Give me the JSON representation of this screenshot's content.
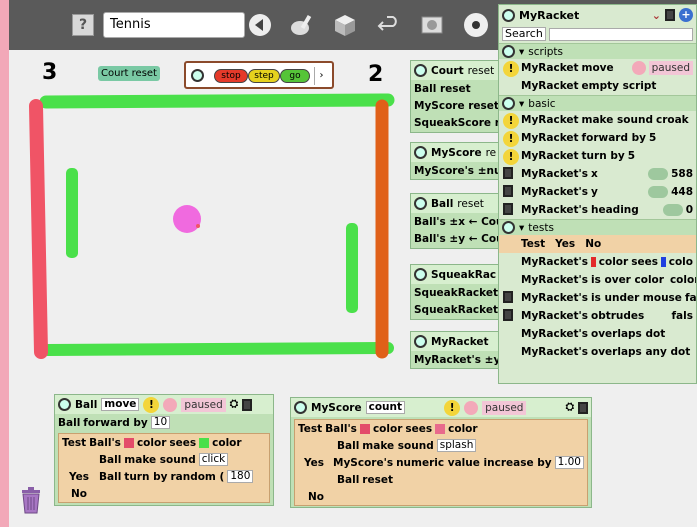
{
  "toolbar": {
    "help_icon": "?",
    "project_name": "Tennis",
    "icons": [
      "back-arrow-icon",
      "paint-icon",
      "object-catalog-icon",
      "undo-icon",
      "navigator-icon",
      "stop-dot-icon"
    ]
  },
  "scores": {
    "left": "3",
    "right": "2"
  },
  "court_reset_button": "Court reset",
  "stop_step_go": {
    "stop": "stop",
    "step": "step",
    "go": "go"
  },
  "colors": {
    "world_bg": "#efefef",
    "topbar_bg": "#5a5a5a",
    "green_wall": "#4ae04a",
    "red_wall": "#f05466",
    "orange_wall": "#e06018",
    "ball": "#f06adf",
    "scriptor_bg": "#bfe0b6"
  },
  "court_scriptor": {
    "title": "Court",
    "title_suffix": "reset",
    "rows": [
      "Ball reset",
      "MyScore reset",
      "SqueakScore re"
    ]
  },
  "myscore_scriptor": {
    "title": "MyScore",
    "title_suffix": "re",
    "rows": [
      "MyScore's ±num"
    ]
  },
  "ball_scriptor": {
    "title": "Ball",
    "title_suffix": "reset",
    "rows": [
      "Ball's ±x ← Cour",
      "Ball's ±y ← Cour"
    ]
  },
  "squeakracket_scriptor": {
    "title": "SqueakRac",
    "rows": [
      "SqueakRacket'",
      "SqueakRacket'"
    ]
  },
  "myracket_scriptor": {
    "title": "MyRacket",
    "rows": [
      "MyRacket's ±y"
    ]
  },
  "ball_move_script": {
    "object": "Ball",
    "script_name": "move",
    "status": "paused",
    "line1_obj": "Ball",
    "line1_cmd": "forward by",
    "line1_val": "10",
    "test_label": "Test",
    "test_obj": "Ball's",
    "test_cmd_1": "color",
    "test_cmd_2": "sees",
    "test_cmd_3": "color",
    "yes_label": "Yes",
    "yes_1_obj": "Ball",
    "yes_1_cmd": "make sound",
    "yes_1_val": "click",
    "yes_2_obj": "Ball",
    "yes_2_cmd": "turn by",
    "yes_2_val": "random (",
    "yes_2_num": "180",
    "no_label": "No"
  },
  "myscore_count_script": {
    "object": "MyScore",
    "script_name": "count",
    "status": "paused",
    "test_label": "Test",
    "test_obj": "Ball's",
    "test_cmd_1": "color",
    "test_cmd_2": "sees",
    "test_cmd_3": "color",
    "yes_label": "Yes",
    "yes_1_obj": "Ball",
    "yes_1_cmd": "make sound",
    "yes_1_val": "splash",
    "yes_2_obj": "MyScore's",
    "yes_2_cmd": "numeric value increase by",
    "yes_2_val": "1.00",
    "yes_3_obj": "Ball",
    "yes_3_cmd": "reset",
    "no_label": "No"
  },
  "viewer": {
    "title": "MyRacket",
    "search_label": "Search",
    "scripts_category": "scripts",
    "scripts_rows": [
      {
        "obj": "MyRacket",
        "cmd": "move",
        "status": "paused"
      },
      {
        "obj": "MyRacket",
        "cmd": "empty script"
      }
    ],
    "basic_category": "basic",
    "basic_rows": [
      {
        "obj": "MyRacket",
        "cmd": "make sound",
        "val": "croak"
      },
      {
        "obj": "MyRacket",
        "cmd": "forward by",
        "val": "5"
      },
      {
        "obj": "MyRacket",
        "cmd": "turn by",
        "val": "5"
      },
      {
        "obj": "MyRacket's",
        "cmd": "x",
        "val": "588"
      },
      {
        "obj": "MyRacket's",
        "cmd": "y",
        "val": "448"
      },
      {
        "obj": "MyRacket's",
        "cmd": "heading",
        "val": "0"
      }
    ],
    "tests_category": "tests",
    "tests_header": {
      "test": "Test",
      "yes": "Yes",
      "no": "No"
    },
    "tests_rows": [
      {
        "obj": "MyRacket's",
        "cmd": "color",
        "cmd2": "sees",
        "tail": "colo"
      },
      {
        "obj": "MyRacket's",
        "cmd": "is over color",
        "tail": "color"
      },
      {
        "obj": "MyRacket's",
        "cmd": "is under mouse",
        "tail": "fals"
      },
      {
        "obj": "MyRacket's",
        "cmd": "obtrudes",
        "tail": "fals"
      },
      {
        "obj": "MyRacket's",
        "cmd": "overlaps dot",
        "tail": ""
      },
      {
        "obj": "MyRacket's",
        "cmd": "overlaps any dot",
        "tail": ""
      }
    ]
  }
}
